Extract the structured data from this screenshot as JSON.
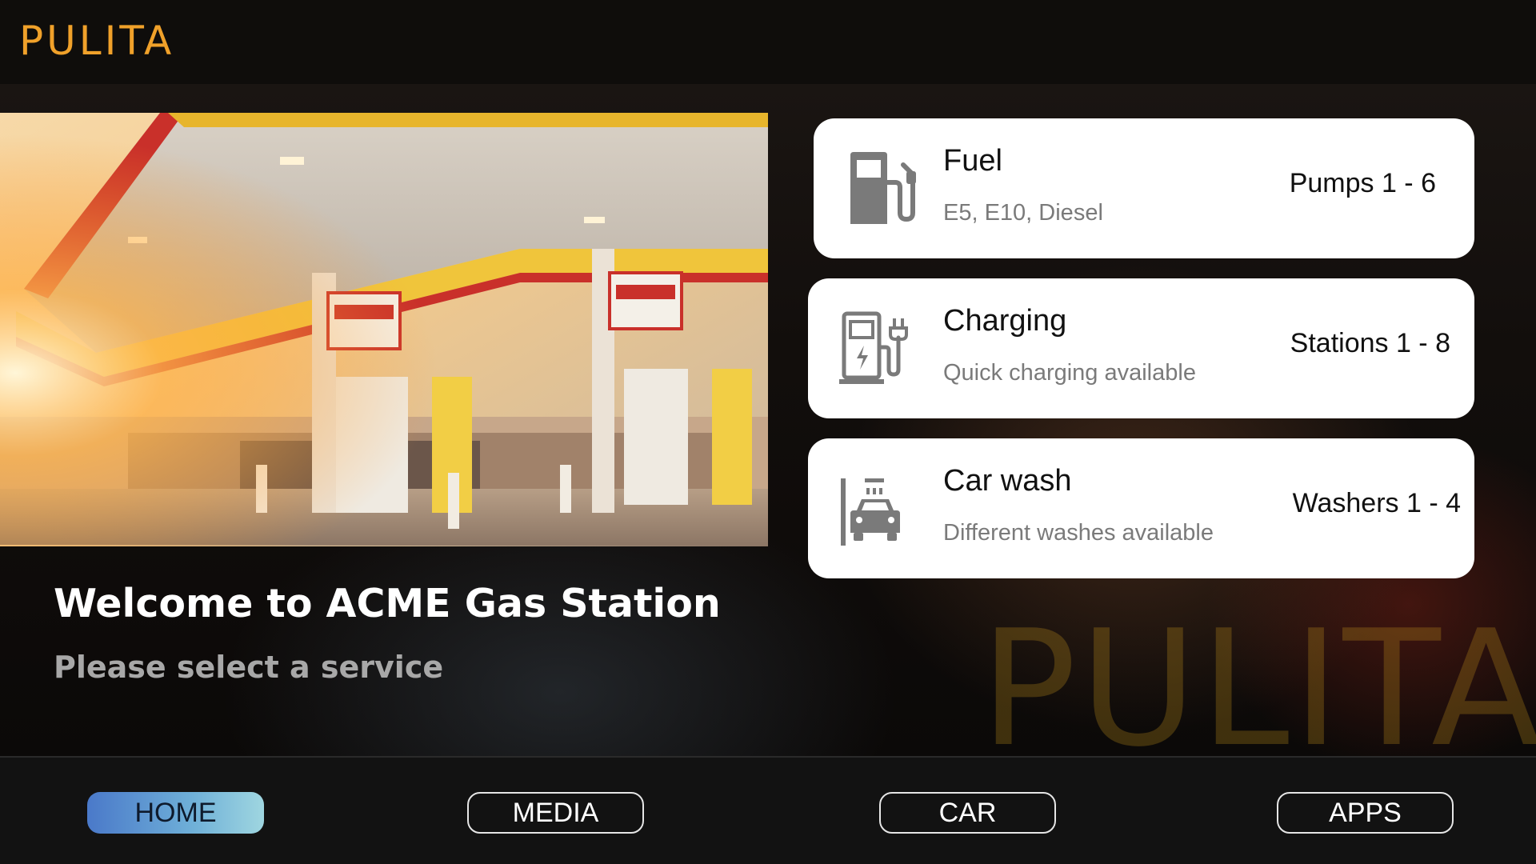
{
  "header": {
    "brand": "PULITA"
  },
  "background": {
    "watermark": "PULITA"
  },
  "welcome": {
    "title": "Welcome to ACME Gas Station",
    "subtitle": "Please select a service"
  },
  "services": [
    {
      "title": "Fuel",
      "description": "E5, E10, Diesel",
      "range": "Pumps 1 - 6",
      "icon": "fuel-pump-icon"
    },
    {
      "title": "Charging",
      "description": "Quick charging available",
      "range": "Stations 1 - 8",
      "icon": "ev-charger-icon"
    },
    {
      "title": "Car wash",
      "description": "Different washes available",
      "range": "Washers 1 - 4",
      "icon": "car-wash-icon"
    }
  ],
  "nav": {
    "items": [
      {
        "label": "HOME",
        "active": true
      },
      {
        "label": "MEDIA",
        "active": false
      },
      {
        "label": "CAR",
        "active": false
      },
      {
        "label": "APPS",
        "active": false
      }
    ]
  },
  "colors": {
    "brand": "#f0a12a",
    "nav_active_start": "#4a79c9",
    "nav_active_end": "#9fd6e0",
    "icon_gray": "#7a7a7a"
  }
}
